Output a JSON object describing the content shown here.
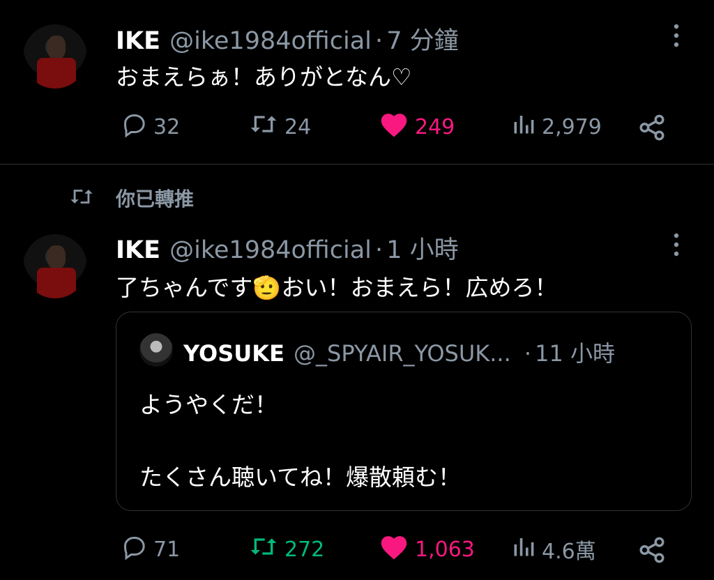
{
  "tweets": [
    {
      "author_name": "IKE",
      "author_handle": "@ike1984official",
      "time_sep": "·",
      "time": "7 分鐘",
      "text": "おまえらぁ！ありがとなん♡",
      "replies": "32",
      "retweets": "24",
      "likes": "249",
      "views": "2,979"
    },
    {
      "retweeted_label": "你已轉推",
      "author_name": "IKE",
      "author_handle": "@ike1984official",
      "time_sep": "·",
      "time": "1 小時",
      "text": "了ちゃんです🫡おい！おまえら！広めろ！",
      "quote": {
        "author_name": "YOSUKE",
        "author_handle": "@_SPYAIR_YOSUK...",
        "time_sep": "·",
        "time": "11 小時",
        "line1": "ようやくだ！",
        "line2": "たくさん聴いてね！爆散頼む！"
      },
      "replies": "71",
      "retweets": "272",
      "likes": "1,063",
      "views": "4.6萬"
    }
  ],
  "colors": {
    "background": "#000000",
    "muted": "#8b98a5",
    "like_active": "#f91880",
    "retweet_active": "#00ba7c",
    "divider": "#2f3336"
  },
  "icons": [
    "more-icon",
    "reply-icon",
    "retweet-icon",
    "like-icon",
    "views-icon",
    "share-icon"
  ]
}
